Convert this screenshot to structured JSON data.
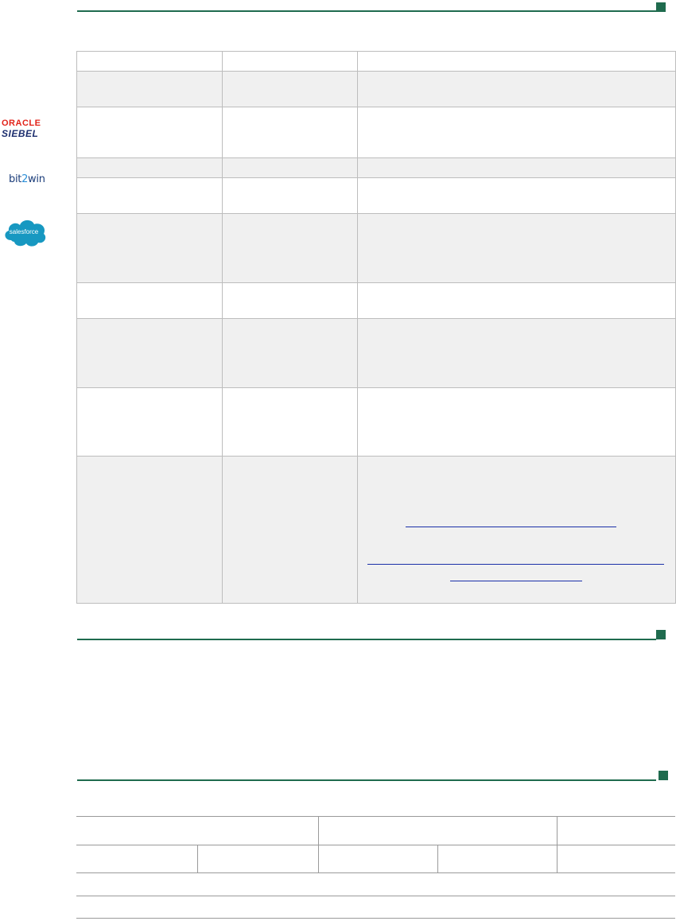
{
  "colors": {
    "rule": "#1f6b4e",
    "row_shade": "#f0f0f0",
    "link": "#1a2fa8",
    "oracle_red": "#e2231a",
    "siebel_navy": "#1d2f6f",
    "salesforce_blue": "#1798c1"
  },
  "logos": {
    "oracle_label": "ORACLE",
    "siebel_label": "SIEBEL",
    "bit_label": "bit",
    "bit_accent": "2",
    "win_label": "win",
    "salesforce_label": "salesforce"
  },
  "table1": {
    "rows": [
      {
        "shaded": false,
        "cells": [
          "",
          "",
          ""
        ]
      },
      {
        "shaded": true,
        "cells": [
          "",
          "",
          ""
        ]
      },
      {
        "shaded": false,
        "cells": [
          "",
          "",
          ""
        ]
      },
      {
        "shaded": true,
        "cells": [
          "",
          "",
          ""
        ]
      },
      {
        "shaded": false,
        "cells": [
          "",
          "",
          ""
        ]
      },
      {
        "shaded": true,
        "cells": [
          "",
          "",
          ""
        ]
      },
      {
        "shaded": false,
        "cells": [
          "",
          "",
          ""
        ]
      },
      {
        "shaded": true,
        "cells": [
          "",
          "",
          ""
        ]
      },
      {
        "shaded": false,
        "cells": [
          "",
          "",
          ""
        ]
      },
      {
        "shaded": true,
        "cells": [
          "",
          "",
          ""
        ]
      }
    ]
  },
  "table2": {
    "header_cells": [
      "",
      "",
      ""
    ],
    "subheader_cells": [
      "",
      "",
      "",
      "",
      ""
    ],
    "rows": [
      "",
      ""
    ]
  }
}
